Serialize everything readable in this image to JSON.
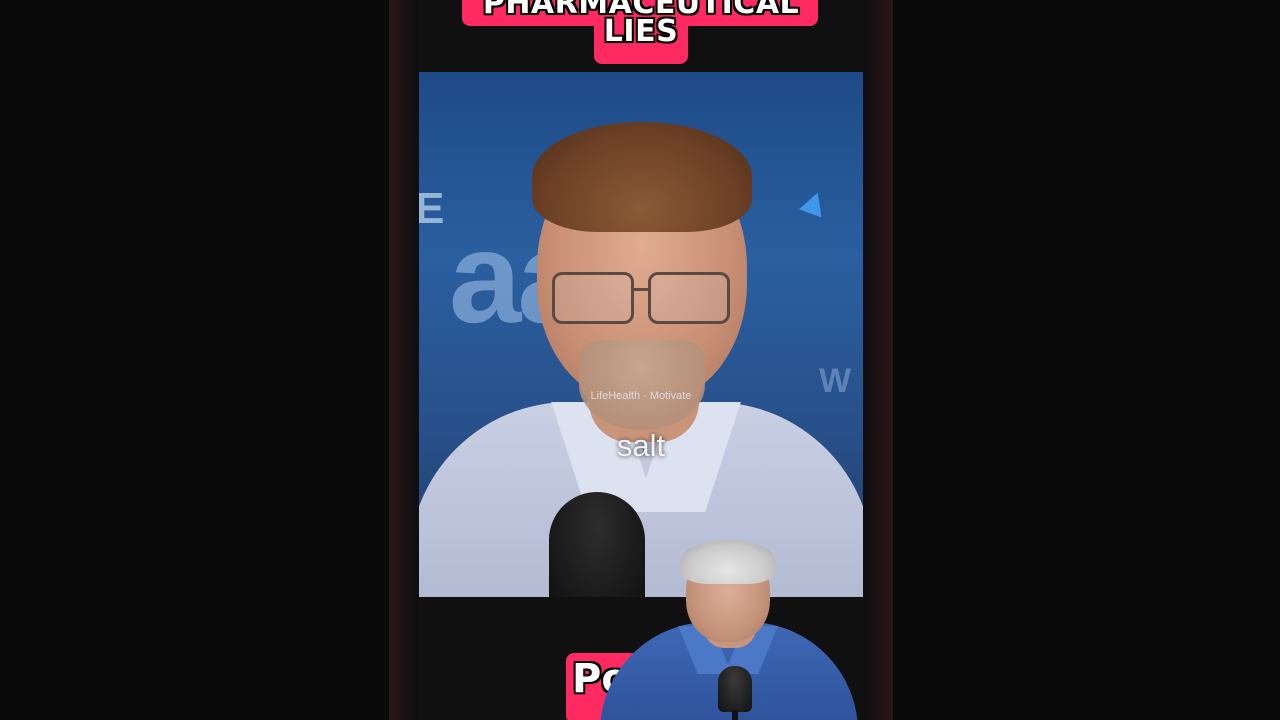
{
  "title": {
    "line1": "PHARMACEUTICAL",
    "line2": "LIES"
  },
  "video": {
    "watermark": "LifeHealth · Motivate",
    "caption": "salt"
  },
  "bottom_badge": {
    "text": "Po"
  },
  "colors": {
    "accent": "#ff2a62",
    "backdrop": "#2a5fa0",
    "page_background": "#0b0b0b"
  }
}
